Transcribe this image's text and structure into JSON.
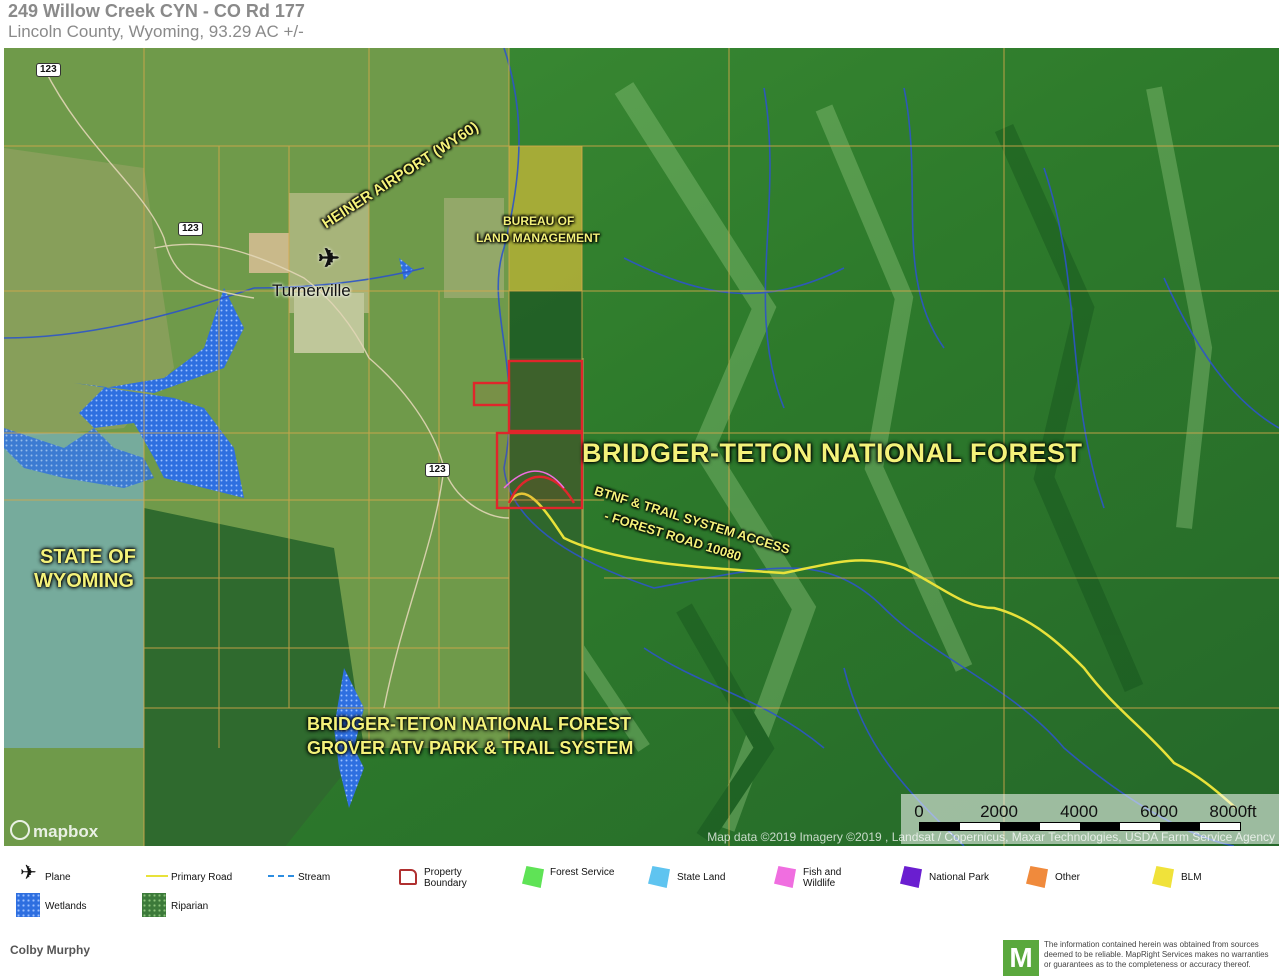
{
  "header": {
    "title": "249 Willow Creek CYN - CO Rd 177",
    "subtitle": "Lincoln County, Wyoming, 93.29 AC +/-"
  },
  "map": {
    "labels": {
      "airport": "HEINER AIRPORT (WY60)",
      "town": "Turnerville",
      "blm_line1": "BUREAU OF",
      "blm_line2": "LAND MANAGEMENT",
      "national_forest": "BRIDGER-TETON NATIONAL FOREST",
      "access_line1": "BTNF & TRAIL SYSTEM ACCESS",
      "access_line2": "- FOREST ROAD 10080",
      "state_line1": "STATE OF",
      "state_line2": "WYOMING",
      "grover_line1": "BRIDGER-TETON NATIONAL FOREST",
      "grover_line2": "GROVER ATV PARK & TRAIL SYSTEM"
    },
    "road_shields": [
      "123",
      "123",
      "123"
    ],
    "scale_labels": [
      "0",
      "2000",
      "4000",
      "6000",
      "8000ft"
    ],
    "attribution": "Map data ©2019  Imagery ©2019 , Landsat / Copernicus, Maxar Technologies, USDA Farm Service Agency",
    "mapbox_label": "mapbox",
    "colors": {
      "forest": "#2f7d2c",
      "property_boundary": "#e0262b",
      "primary_road": "#e8e23a",
      "stream": "#2d55c8",
      "wetlands": "#2e6fe0",
      "blm": "#c2b53a",
      "state_land": "#7ab3c8",
      "parcel_lines": "#d6a84a"
    }
  },
  "legend": {
    "items": [
      {
        "label": "Plane",
        "icon": "plane-icon"
      },
      {
        "label": "Primary Road",
        "icon": "road-line-icon"
      },
      {
        "label": "Stream",
        "icon": "stream-line-icon"
      },
      {
        "label": "Property Boundary",
        "icon": "property-boundary-icon"
      },
      {
        "label": "Forest Service",
        "icon": "forest-service-swatch"
      },
      {
        "label": "State Land",
        "icon": "state-land-swatch"
      },
      {
        "label": "Fish and Wildlife",
        "icon": "fish-wildlife-swatch"
      },
      {
        "label": "National Park",
        "icon": "national-park-swatch"
      },
      {
        "label": "Other",
        "icon": "other-swatch"
      },
      {
        "label": "BLM",
        "icon": "blm-swatch"
      },
      {
        "label": "Wetlands",
        "icon": "wetlands-swatch"
      },
      {
        "label": "Riparian",
        "icon": "riparian-swatch"
      }
    ],
    "colors": {
      "forest_service": "#5fe356",
      "state_land": "#5fc4f0",
      "fish_wildlife": "#f06ee0",
      "national_park": "#6a1ed0",
      "other": "#f08a3c",
      "blm": "#f0e23a",
      "wetlands": "#2e6fe0",
      "riparian": "#3c7a3a"
    }
  },
  "footer": {
    "agent": "Colby Murphy",
    "logo_letter": "M",
    "disclaimer": "The information contained herein was obtained from sources deemed to be reliable. MapRight Services makes no warranties or guarantees as to the completeness or accuracy thereof."
  }
}
